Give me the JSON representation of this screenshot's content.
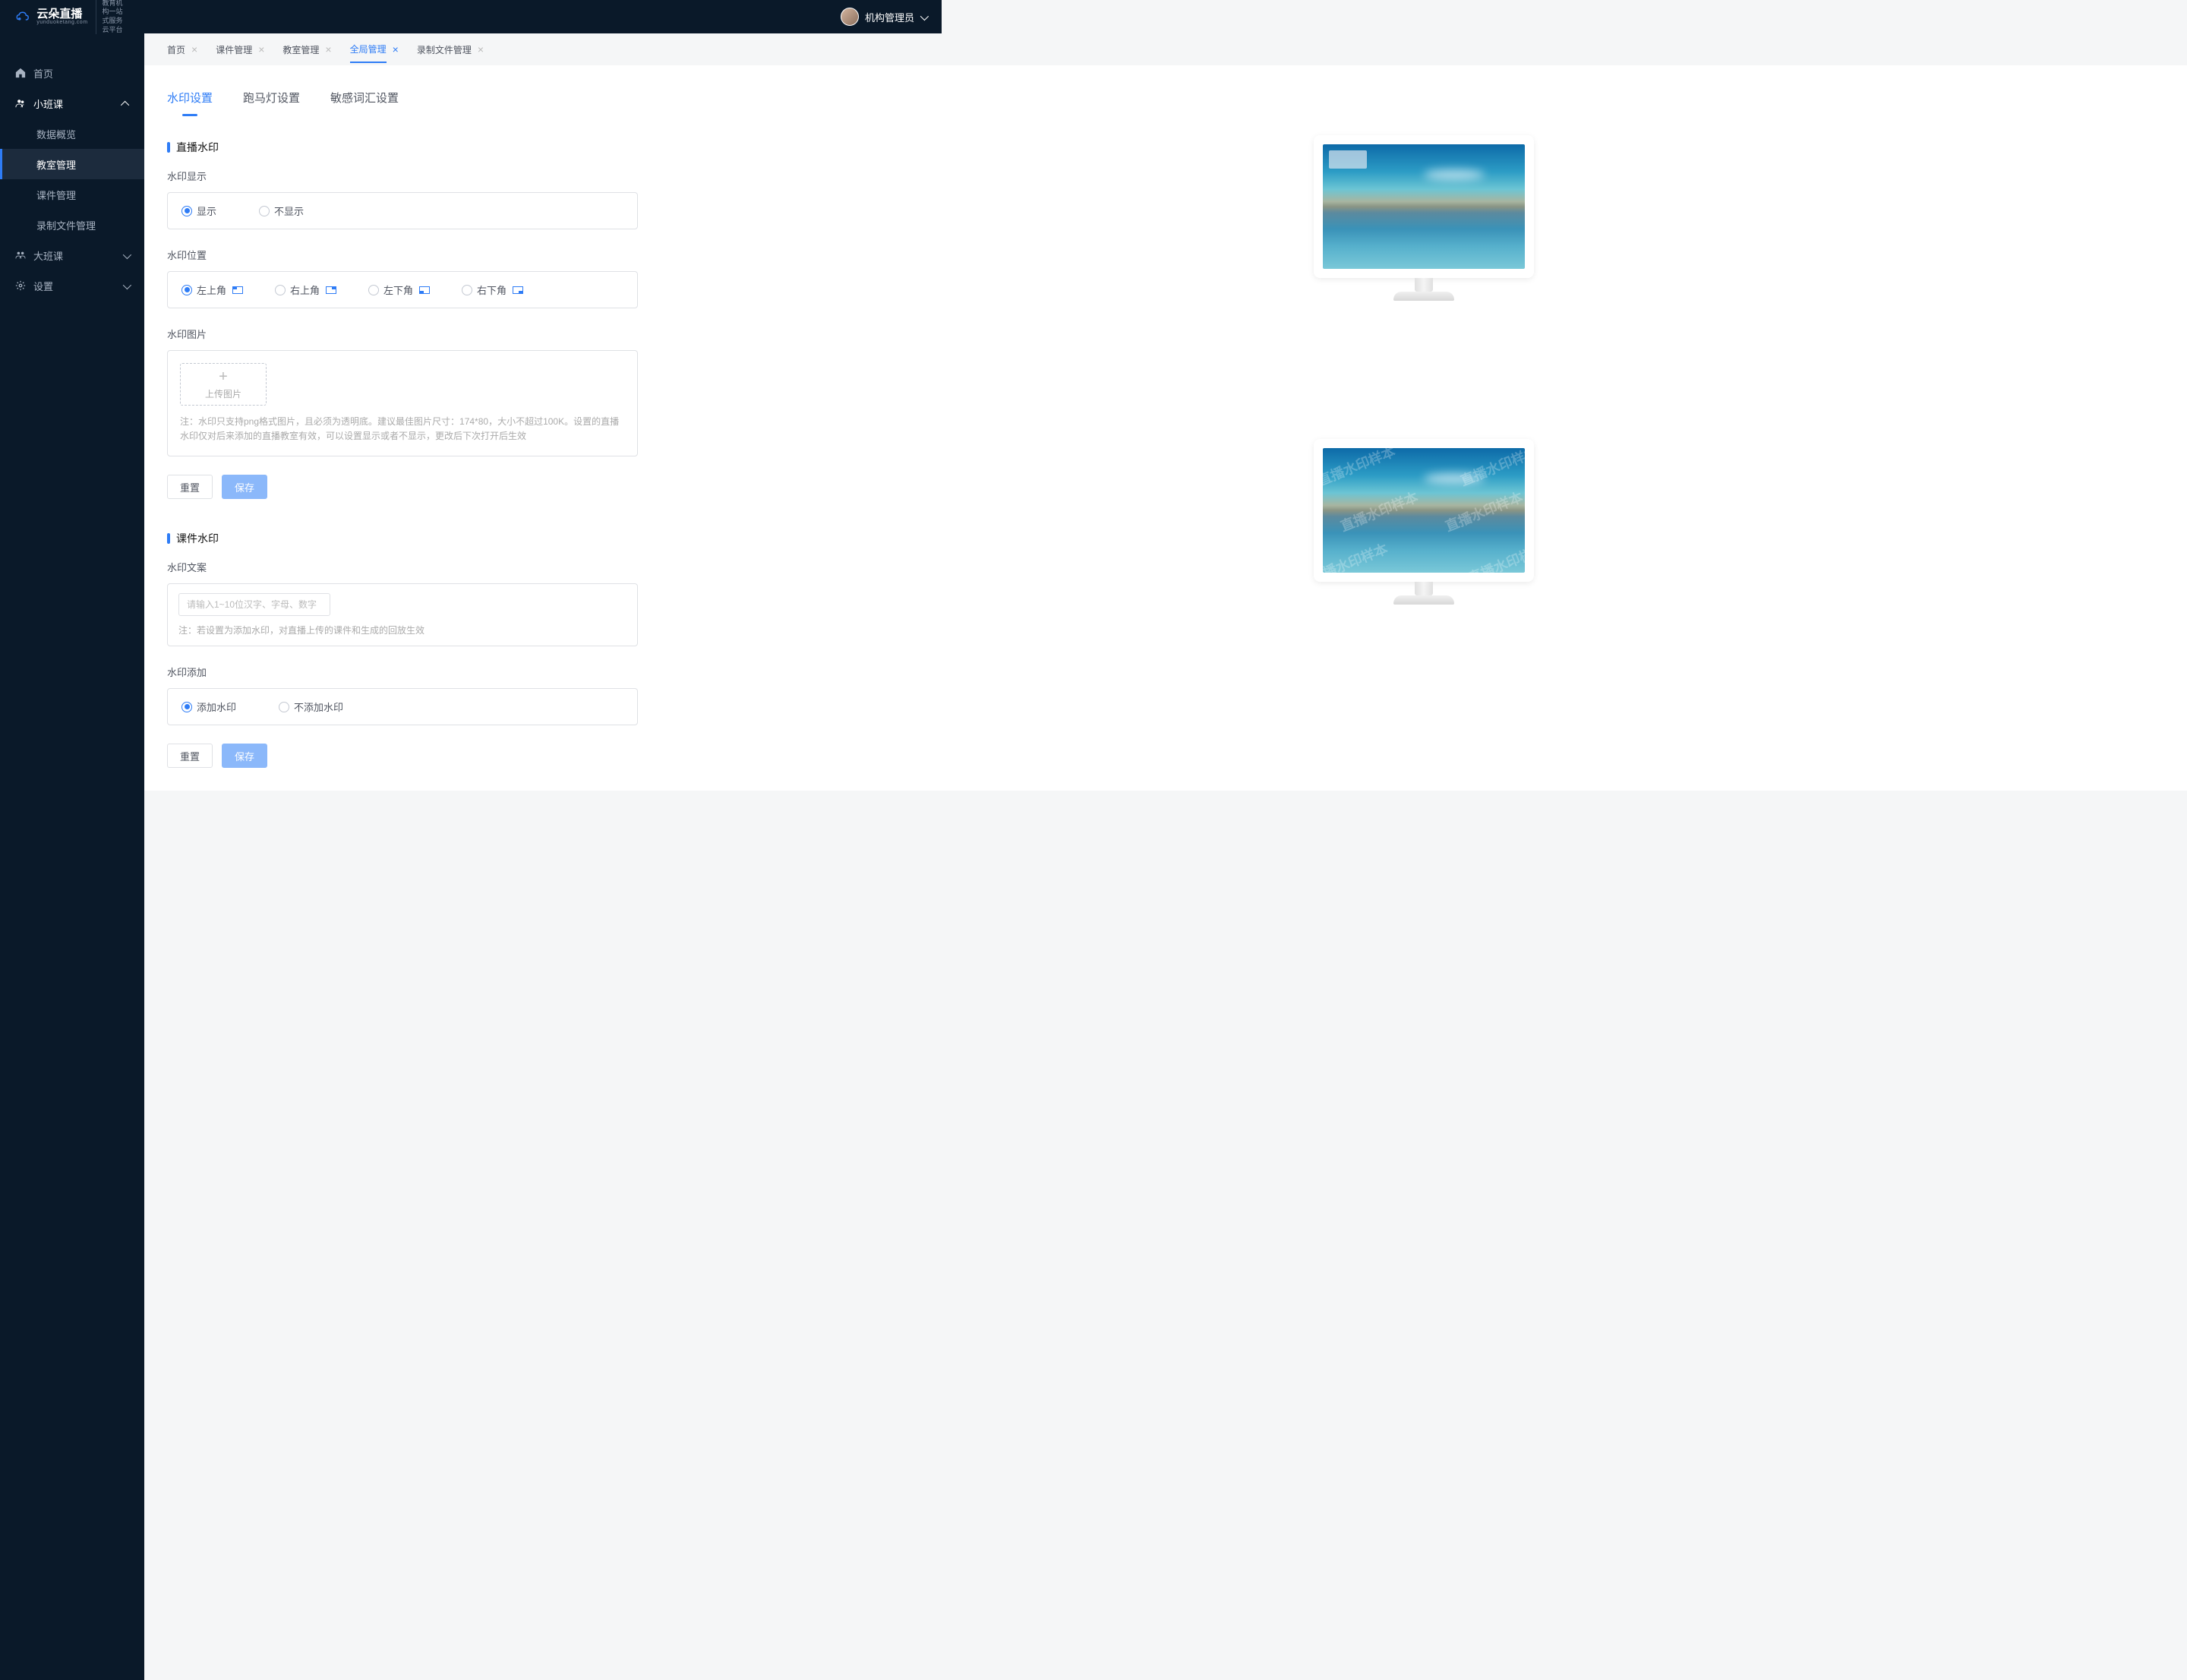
{
  "header": {
    "user_label": "机构管理员"
  },
  "logo": {
    "title": "云朵直播",
    "subtitle": "yunduoketang.com",
    "tagline_line1": "教育机构一站",
    "tagline_line2": "式服务云平台"
  },
  "sidebar": {
    "home": "首页",
    "small_class": "小班课",
    "items": {
      "data_overview": "数据概览",
      "classroom_mgmt": "教室管理",
      "courseware_mgmt": "课件管理",
      "recording_mgmt": "录制文件管理"
    },
    "big_class": "大班课",
    "settings": "设置"
  },
  "tabs": [
    {
      "label": "首页",
      "active": false
    },
    {
      "label": "课件管理",
      "active": false
    },
    {
      "label": "教室管理",
      "active": false
    },
    {
      "label": "全局管理",
      "active": true
    },
    {
      "label": "录制文件管理",
      "active": false
    }
  ],
  "sub_tabs": {
    "watermark": "水印设置",
    "marquee": "跑马灯设置",
    "sensitive": "敏感词汇设置"
  },
  "section1": {
    "title": "直播水印",
    "display_label": "水印显示",
    "display_show": "显示",
    "display_hide": "不显示",
    "position_label": "水印位置",
    "pos_tl": "左上角",
    "pos_tr": "右上角",
    "pos_bl": "左下角",
    "pos_br": "右下角",
    "image_label": "水印图片",
    "upload_text": "上传图片",
    "hint": "注：水印只支持png格式图片，且必须为透明底。建议最佳图片尺寸：174*80，大小不超过100K。设置的直播水印仅对后来添加的直播教室有效，可以设置显示或者不显示，更改后下次打开后生效",
    "reset_btn": "重置",
    "save_btn": "保存"
  },
  "section2": {
    "title": "课件水印",
    "text_label": "水印文案",
    "placeholder": "请输入1~10位汉字、字母、数字",
    "hint": "注：若设置为添加水印，对直播上传的课件和生成的回放生效",
    "add_label": "水印添加",
    "add_yes": "添加水印",
    "add_no": "不添加水印",
    "reset_btn": "重置",
    "save_btn": "保存",
    "diag_sample": "直播水印样本"
  }
}
